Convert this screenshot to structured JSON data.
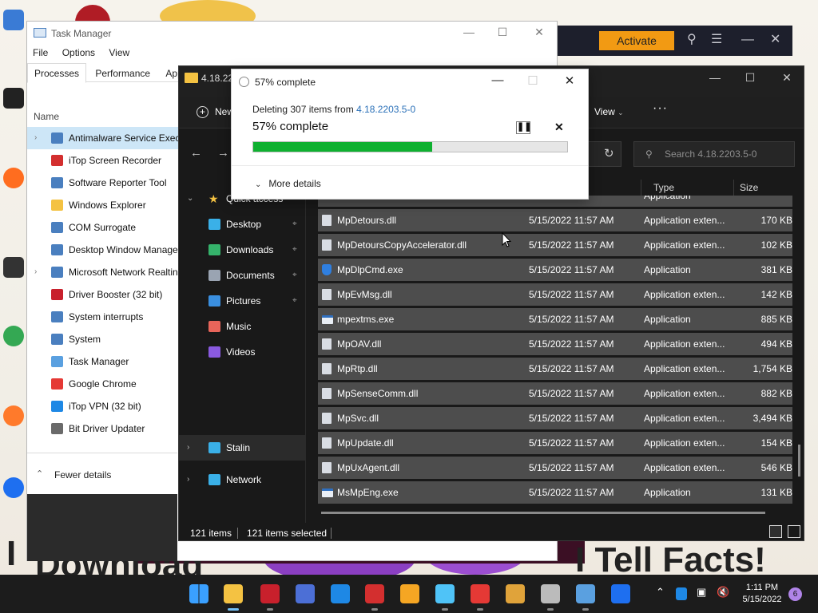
{
  "background_app": {
    "activate_label": "Activate"
  },
  "task_manager": {
    "title": "Task Manager",
    "menu": [
      "File",
      "Options",
      "View"
    ],
    "tabs": [
      "Processes",
      "Performance",
      "App his"
    ],
    "column_name": "Name",
    "processes": [
      {
        "name": "Antimalware Service Execu",
        "expandable": true,
        "selected": true,
        "icon": "app-window-icon"
      },
      {
        "name": "iTop Screen Recorder",
        "expandable": false,
        "icon": "screen-recorder-icon"
      },
      {
        "name": "Software Reporter Tool",
        "expandable": false,
        "icon": "app-window-icon"
      },
      {
        "name": "Windows Explorer",
        "expandable": false,
        "icon": "folder-icon"
      },
      {
        "name": "COM Surrogate",
        "expandable": false,
        "icon": "app-window-icon"
      },
      {
        "name": "Desktop Window Manager",
        "expandable": false,
        "icon": "app-window-icon"
      },
      {
        "name": "Microsoft Network Realtin",
        "expandable": true,
        "icon": "app-window-icon"
      },
      {
        "name": "Driver Booster (32 bit)",
        "expandable": false,
        "icon": "driver-booster-icon"
      },
      {
        "name": "System interrupts",
        "expandable": false,
        "icon": "app-window-icon"
      },
      {
        "name": "System",
        "expandable": false,
        "icon": "app-window-icon"
      },
      {
        "name": "Task Manager",
        "expandable": false,
        "icon": "task-manager-icon"
      },
      {
        "name": "Google Chrome",
        "expandable": false,
        "icon": "chrome-icon"
      },
      {
        "name": "iTop VPN (32 bit)",
        "expandable": false,
        "icon": "vpn-shield-icon"
      },
      {
        "name": "Bit Driver Updater",
        "expandable": false,
        "icon": "driver-updater-icon"
      }
    ],
    "fewer_details": "Fewer details"
  },
  "explorer": {
    "tab_title": "4.18.22",
    "new_label": "New",
    "view_label": "View",
    "more_label": "···",
    "search_placeholder": "Search 4.18.2203.5-0",
    "nav": {
      "quick_access": "Quick access",
      "items": [
        {
          "label": "Desktop",
          "pinned": true,
          "icon": "desktop-icon"
        },
        {
          "label": "Downloads",
          "pinned": true,
          "icon": "download-icon"
        },
        {
          "label": "Documents",
          "pinned": true,
          "icon": "documents-icon"
        },
        {
          "label": "Pictures",
          "pinned": true,
          "icon": "pictures-icon"
        },
        {
          "label": "Music",
          "pinned": false,
          "icon": "music-icon"
        },
        {
          "label": "Videos",
          "pinned": false,
          "icon": "videos-icon"
        }
      ],
      "this_pc": "Stalin",
      "network": "Network"
    },
    "columns": {
      "type": "Type",
      "size": "Size"
    },
    "files": [
      {
        "name": "MpDetours.dll",
        "date": "5/15/2022 11:57 AM",
        "type": "Application exten...",
        "size": "170 KB",
        "icon": "dll-file-icon"
      },
      {
        "name": "MpDetoursCopyAccelerator.dll",
        "date": "5/15/2022 11:57 AM",
        "type": "Application exten...",
        "size": "102 KB",
        "icon": "dll-file-icon"
      },
      {
        "name": "MpDlpCmd.exe",
        "date": "5/15/2022 11:57 AM",
        "type": "Application",
        "size": "381 KB",
        "icon": "defender-shield-icon"
      },
      {
        "name": "MpEvMsg.dll",
        "date": "5/15/2022 11:57 AM",
        "type": "Application exten...",
        "size": "142 KB",
        "icon": "dll-file-icon"
      },
      {
        "name": "mpextms.exe",
        "date": "5/15/2022 11:57 AM",
        "type": "Application",
        "size": "885 KB",
        "icon": "exe-window-icon"
      },
      {
        "name": "MpOAV.dll",
        "date": "5/15/2022 11:57 AM",
        "type": "Application exten...",
        "size": "494 KB",
        "icon": "dll-file-icon"
      },
      {
        "name": "MpRtp.dll",
        "date": "5/15/2022 11:57 AM",
        "type": "Application exten...",
        "size": "1,754 KB",
        "icon": "dll-file-icon"
      },
      {
        "name": "MpSenseComm.dll",
        "date": "5/15/2022 11:57 AM",
        "type": "Application exten...",
        "size": "882 KB",
        "icon": "dll-file-icon"
      },
      {
        "name": "MpSvc.dll",
        "date": "5/15/2022 11:57 AM",
        "type": "Application exten...",
        "size": "3,494 KB",
        "icon": "dll-file-icon"
      },
      {
        "name": "MpUpdate.dll",
        "date": "5/15/2022 11:57 AM",
        "type": "Application exten...",
        "size": "154 KB",
        "icon": "dll-file-icon"
      },
      {
        "name": "MpUxAgent.dll",
        "date": "5/15/2022 11:57 AM",
        "type": "Application exten...",
        "size": "546 KB",
        "icon": "dll-file-icon"
      },
      {
        "name": "MsMpEng.exe",
        "date": "5/15/2022 11:57 AM",
        "type": "Application",
        "size": "131 KB",
        "icon": "exe-window-icon"
      }
    ],
    "partial_top_row": {
      "type": "Application"
    },
    "status": {
      "items": "121 items",
      "selected": "121 items selected"
    }
  },
  "progress_dialog": {
    "title": "57% complete",
    "deleting_prefix": "Deleting 307 items from ",
    "deleting_source": "4.18.2203.5-0",
    "headline": "57% complete",
    "percent": 57,
    "more_details": "More details",
    "bar_color": "#0fb030"
  },
  "taskbar": {
    "apps": [
      {
        "name": "start-icon",
        "color": "#3aa0ff"
      },
      {
        "name": "file-explorer-icon",
        "color": "#f4c242",
        "active": true
      },
      {
        "name": "driver-booster-icon",
        "color": "#c8202c",
        "running": true
      },
      {
        "name": "app-icon",
        "color": "#4c6fd6"
      },
      {
        "name": "vpn-shield-icon",
        "color": "#1e88e5"
      },
      {
        "name": "screen-recorder-icon",
        "color": "#d32f2f",
        "running": true
      },
      {
        "name": "brave-icon",
        "color": "#f5a623"
      },
      {
        "name": "camera-icon",
        "color": "#4fc3f7",
        "running": true
      },
      {
        "name": "chrome-icon",
        "color": "#e53935",
        "running": true
      },
      {
        "name": "lock-icon",
        "color": "#e0a33a"
      },
      {
        "name": "settings-gear-icon",
        "color": "#bbbbbb",
        "running": true
      },
      {
        "name": "task-manager-icon",
        "color": "#5aa0e0",
        "running": true
      },
      {
        "name": "malwarebytes-icon",
        "color": "#1e6ff0"
      }
    ],
    "time": "1:11 PM",
    "date": "5/15/2022",
    "notification_count": "6"
  }
}
